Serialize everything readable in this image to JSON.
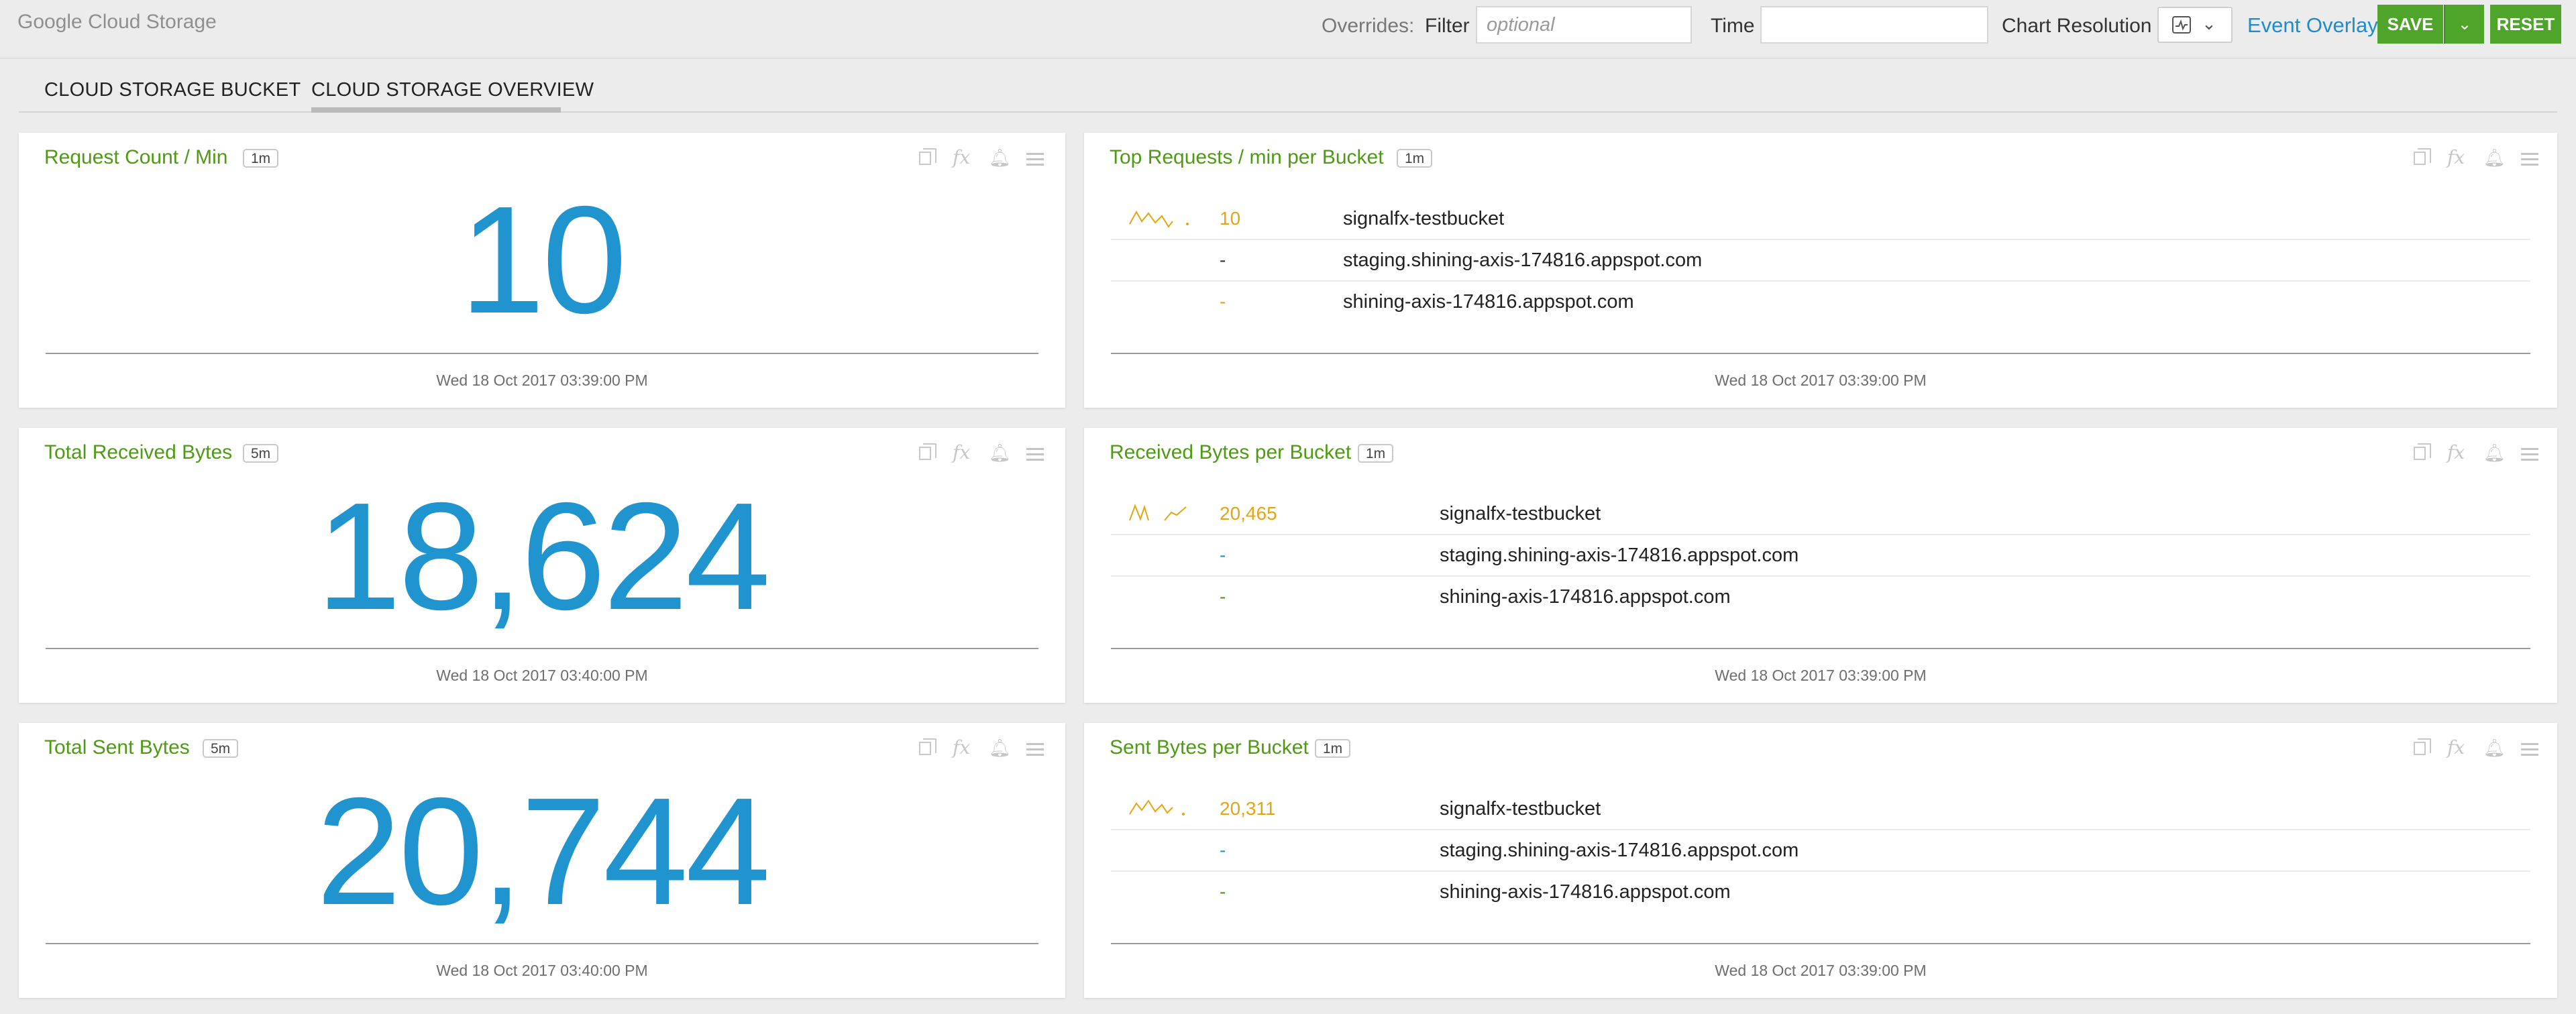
{
  "header": {
    "app_title": "Google Cloud Storage",
    "overrides_label": "Overrides:",
    "filter_label": "Filter",
    "filter_placeholder": "optional",
    "filter_value": "",
    "time_label": "Time",
    "time_value": "",
    "chart_resolution_label": "Chart Resolution",
    "chart_resolution_icon": "line-chart-icon",
    "event_overlay_label": "Event Overlay",
    "save_label": "SAVE",
    "reset_label": "RESET"
  },
  "tabs": [
    {
      "label": "CLOUD STORAGE BUCKET",
      "active": false
    },
    {
      "label": "CLOUD STORAGE OVERVIEW",
      "active": true
    }
  ],
  "colors": {
    "title_green": "#4e9a13",
    "value_blue": "#1f94cf",
    "list_orange": "#e5a412",
    "button_green": "#4fa42a",
    "link_blue": "#1e8ccf"
  },
  "panels": [
    {
      "id": "request-count",
      "title": "Request Count / Min",
      "resolution": "1m",
      "type": "single-value",
      "value": "10",
      "timestamp": "Wed 18 Oct 2017 03:39:00 PM"
    },
    {
      "id": "top-requests",
      "title": "Top Requests / min per Bucket",
      "resolution": "1m",
      "type": "list",
      "rows": [
        {
          "value": "10",
          "name": "signalfx-testbucket",
          "has_sparkline": true
        },
        {
          "value": "-",
          "name": "staging.shining-axis-174816.appspot.com",
          "has_sparkline": false
        },
        {
          "value": "-",
          "name": "shining-axis-174816.appspot.com",
          "has_sparkline": false
        }
      ],
      "timestamp": "Wed 18 Oct 2017 03:39:00 PM"
    },
    {
      "id": "total-received",
      "title": "Total Received Bytes",
      "resolution": "5m",
      "type": "single-value",
      "value": "18,624",
      "timestamp": "Wed 18 Oct 2017 03:40:00 PM"
    },
    {
      "id": "received-per-bucket",
      "title": "Received Bytes per Bucket",
      "resolution": "1m",
      "type": "list",
      "rows": [
        {
          "value": "20,465",
          "name": "signalfx-testbucket",
          "has_sparkline": true
        },
        {
          "value": "-",
          "name": "staging.shining-axis-174816.appspot.com",
          "has_sparkline": false
        },
        {
          "value": "-",
          "name": "shining-axis-174816.appspot.com",
          "has_sparkline": false
        }
      ],
      "timestamp": "Wed 18 Oct 2017 03:39:00 PM"
    },
    {
      "id": "total-sent",
      "title": "Total Sent Bytes",
      "resolution": "5m",
      "type": "single-value",
      "value": "20,744",
      "timestamp": "Wed 18 Oct 2017 03:40:00 PM"
    },
    {
      "id": "sent-per-bucket",
      "title": "Sent Bytes per Bucket",
      "resolution": "1m",
      "type": "list",
      "rows": [
        {
          "value": "20,311",
          "name": "signalfx-testbucket",
          "has_sparkline": true
        },
        {
          "value": "-",
          "name": "staging.shining-axis-174816.appspot.com",
          "has_sparkline": false
        },
        {
          "value": "-",
          "name": "shining-axis-174816.appspot.com",
          "has_sparkline": false
        }
      ],
      "timestamp": "Wed 18 Oct 2017 03:39:00 PM"
    }
  ]
}
